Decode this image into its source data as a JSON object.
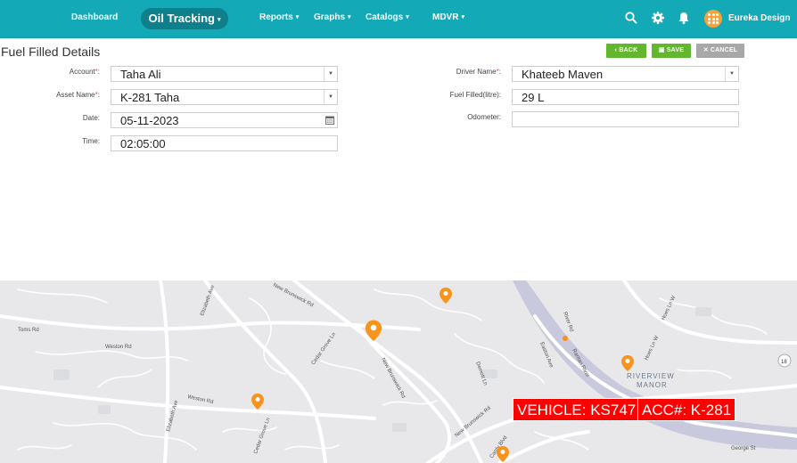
{
  "nav": {
    "dashboard": "Dashboard",
    "oil_tracking": "Oil Tracking",
    "reports": "Reports",
    "graphs": "Graphs",
    "catalogs": "Catalogs",
    "mdvr": "MDVR",
    "user_name": "Eureka Design",
    "icons": [
      "search-icon",
      "gear-icon",
      "bell-icon",
      "avatar"
    ],
    "color": "#14a9b6"
  },
  "form": {
    "title": "Fuel Filled Details",
    "buttons": {
      "back": "BACK",
      "save": "SAVE",
      "cancel": "CANCEL"
    },
    "account": {
      "label": "Account",
      "value": "Taha Ali"
    },
    "asset_name": {
      "label": "Asset Name",
      "value": "K-281 Taha"
    },
    "date": {
      "label": "Date:",
      "value": "05-11-2023"
    },
    "time": {
      "label": "Time:",
      "value": "02:05:00"
    },
    "driver_name": {
      "label": "Driver Name",
      "value": "Khateeb Maven"
    },
    "fuel_filled": {
      "label": "Fuel Filled(litre):",
      "value": "29 L"
    },
    "odometer": {
      "label": "Odometer:",
      "value": ""
    },
    "required_mark": "*",
    "colon": ":"
  },
  "map": {
    "streets": [
      "Toms Rd",
      "Weston Rd",
      "Weston Rd",
      "Elizabeth Ave",
      "Elizabeth Ave",
      "Cedar Grove Ln",
      "Cedar Grove Ln",
      "New Brunswick Rd",
      "New Brunswick Rd",
      "Demott Ln",
      "Easton Ave",
      "River Rd",
      "Hoes Ln W",
      "Hoes Ln W",
      "Raritan River",
      "Cardy Blvd",
      "George St",
      "New Brunswick Rd"
    ],
    "place": [
      "RIVERVIEW",
      "MANOR"
    ],
    "route_shield": "18",
    "overlays": {
      "vehicle": "VEHICLE: KS747",
      "account": "ACC#: K-281"
    },
    "marker_color": "#f7941d"
  }
}
